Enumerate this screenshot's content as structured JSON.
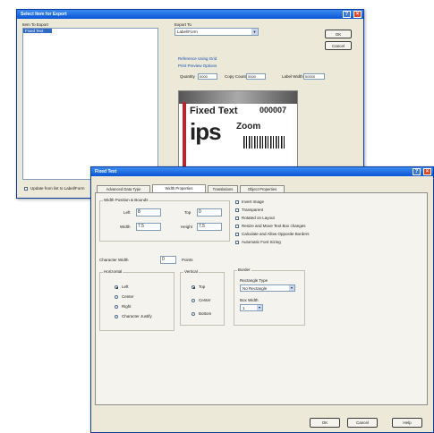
{
  "back_dialog": {
    "title": "Select Item for Export",
    "list_label": "Item To Export",
    "list_items": [
      "Fixed Text"
    ],
    "export_to_label": "Export To",
    "export_to_value": "Label/Form",
    "output_link": "Reference Using Grid",
    "sub_link": "Print Preview Options",
    "fields": {
      "label1": "Quantity",
      "val1": "0000",
      "label2": "Copy Count",
      "val2": "0000",
      "label3": "Label Width",
      "val3": "00000"
    },
    "ok_label": "OK",
    "cancel_label": "Cancel",
    "checkbox_label": "Update from list to Label/Form",
    "preview": {
      "text1": "Fixed Text",
      "code": "000007",
      "logo": "ips",
      "sub": "Zoom"
    }
  },
  "front_dialog": {
    "title": "Fixed Text",
    "tabs": [
      "Advanced Data Type",
      "Width Properties",
      "Translations",
      "Object Properties"
    ],
    "position_group": "Width Position & Bounds",
    "left_label": "Left",
    "left_value": "8",
    "top_label": "Top",
    "top_value": "0",
    "width_label": "Width",
    "width_value": "7.5",
    "height_label": "Height",
    "height_value": "7.5",
    "char_width_label": "Character Width",
    "char_width_value": "0",
    "char_width_unit": "Points",
    "horizontal_group": "Horizontal",
    "horizontal_options": [
      "Left",
      "Center",
      "Right",
      "Character Justify"
    ],
    "vertical_group": "Vertical",
    "vertical_options": [
      "Top",
      "Center",
      "Bottom"
    ],
    "checkboxes": [
      "Invert Image",
      "Transparent",
      "Rotated on Layout",
      "Resize and Move Text Box changes",
      "Calculate and Allow Opposite Borders",
      "Automatic Font Sizing"
    ],
    "border_group": "Border",
    "rect_type_label": "Rectangle Type",
    "rect_type_value": "No Rectangle",
    "box_width_label": "Box Width",
    "box_width_value": "1",
    "ok_label": "OK",
    "cancel_label": "Cancel",
    "help_label": "Help"
  },
  "colors": {
    "titlebar": "#0b55d6",
    "dialog_bg": "#ece9d8",
    "close": "#d8482a"
  },
  "icons": [
    "help-icon",
    "close-icon",
    "dropdown-arrow-icon"
  ]
}
